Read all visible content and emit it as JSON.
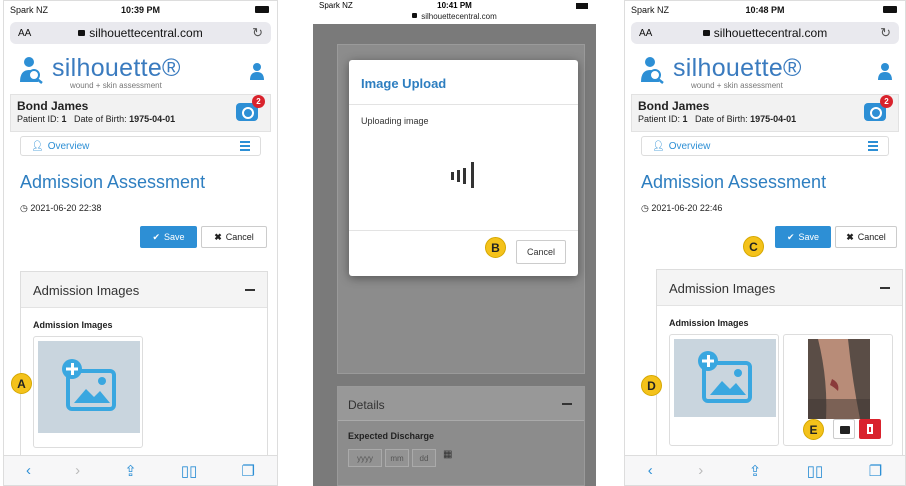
{
  "phones": [
    {
      "status": {
        "carrier": "Spark NZ",
        "time": "10:39 PM"
      },
      "url": {
        "aa": "AA",
        "domain": "silhouettecentral.com"
      },
      "logo": {
        "word": "silhouette®",
        "sub": "wound + skin assessment"
      },
      "patient": {
        "name": "Bond James",
        "ids_prefix": "Patient ID: ",
        "id": "1",
        "dob_prefix": "   Date of Birth: ",
        "dob": "1975-04-01",
        "badge": "2"
      },
      "nav": {
        "overview": "Overview"
      },
      "title": "Admission Assessment",
      "date": "2021-06-20 22:38",
      "buttons": {
        "save": "Save",
        "cancel": "Cancel"
      },
      "panel": {
        "head": "Admission Images",
        "sub": "Admission Images"
      },
      "marker": "A"
    },
    {
      "status": {
        "carrier": "Spark NZ",
        "time": "10:41 PM"
      },
      "url": {
        "domain": "silhouettecentral.com"
      },
      "modal": {
        "title": "Image Upload",
        "text": "Uploading image",
        "cancel": "Cancel"
      },
      "details": {
        "head": "Details",
        "label": "Expected Discharge",
        "placeholders": [
          "yyyy",
          "mm",
          "dd"
        ]
      },
      "marker": "B"
    },
    {
      "status": {
        "carrier": "Spark NZ",
        "time": "10:48 PM"
      },
      "url": {
        "aa": "AA",
        "domain": "silhouettecentral.com"
      },
      "logo": {
        "word": "silhouette®",
        "sub": "wound + skin assessment"
      },
      "patient": {
        "name": "Bond James",
        "ids_prefix": "Patient ID: ",
        "id": "1",
        "dob_prefix": "   Date of Birth: ",
        "dob": "1975-04-01",
        "badge": "2"
      },
      "nav": {
        "overview": "Overview"
      },
      "title": "Admission Assessment",
      "date": "2021-06-20 22:46",
      "buttons": {
        "save": "Save",
        "cancel": "Cancel"
      },
      "panel": {
        "head": "Admission Images",
        "sub": "Admission Images"
      },
      "markers": [
        "C",
        "D",
        "E"
      ]
    }
  ],
  "colors": {
    "accent": "#2d8fd5",
    "title": "#2d7ec0",
    "badge": "#d9232d",
    "marker": "#f4c21b",
    "delete": "#d9232d"
  },
  "icons": [
    "lock-icon",
    "reload-icon",
    "logo-icon",
    "user-icon",
    "camera-icon",
    "person-icon",
    "menu-icon",
    "clock-icon",
    "check-icon",
    "x-icon",
    "add-image-icon",
    "back-icon",
    "forward-icon",
    "share-icon",
    "bookmarks-icon",
    "tabs-icon",
    "spinner-icon",
    "calendar-icon",
    "trash-icon"
  ]
}
